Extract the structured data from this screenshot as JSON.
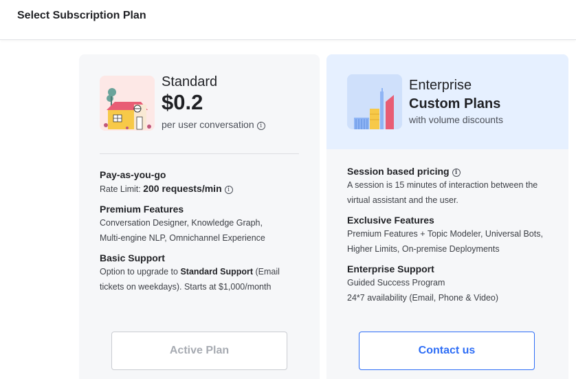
{
  "header": {
    "title": "Select Subscription Plan"
  },
  "standard": {
    "name": "Standard",
    "price": "$0.2",
    "unit": "per user conversation",
    "illustration_icon": "house-illustration",
    "sections": {
      "payg": {
        "title": "Pay-as-you-go",
        "rate_label": "Rate Limit:",
        "rate_value": "200 requests/min"
      },
      "premium": {
        "title": "Premium Features",
        "line1": "Conversation Designer, Knowledge Graph,",
        "line2": "Multi-engine NLP, Omnichannel Experience"
      },
      "support": {
        "title": "Basic Support",
        "line1_pre": "Option to upgrade to ",
        "line1_bold": "Standard Support",
        "line1_post": " (Email",
        "line2": "tickets on weekdays). Starts at $1,000/month"
      }
    },
    "button_label": "Active Plan"
  },
  "enterprise": {
    "name": "Enterprise",
    "custom": "Custom Plans",
    "sub": "with volume discounts",
    "illustration_icon": "city-buildings-illustration",
    "sections": {
      "session": {
        "title": "Session based pricing",
        "line1": "A session is 15 minutes of interaction between the",
        "line2": "virtual assistant and the user."
      },
      "exclusive": {
        "title": "Exclusive Features",
        "line1": "Premium Features + Topic Modeler, Universal Bots,",
        "line2": "Higher Limits, On-premise Deployments"
      },
      "support": {
        "title": "Enterprise Support",
        "line1": "Guided Success Program",
        "line2": "24*7 availability (Email, Phone & Video)"
      }
    },
    "button_label": "Contact us"
  },
  "colors": {
    "accent": "#2d6df6",
    "card_bg": "#f6f7f9",
    "enterprise_header_bg": "#e6f0ff"
  }
}
